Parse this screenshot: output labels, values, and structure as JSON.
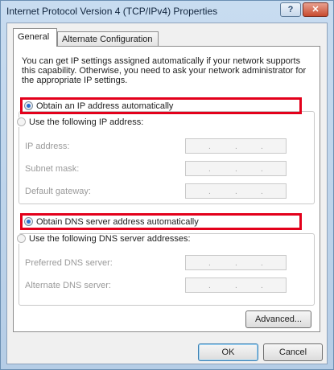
{
  "window": {
    "title": "Internet Protocol Version 4 (TCP/IPv4) Properties",
    "help_label": "?",
    "close_label": "✕"
  },
  "tabs": [
    {
      "label": "General",
      "selected": true
    },
    {
      "label": "Alternate Configuration",
      "selected": false
    }
  ],
  "description": "You can get IP settings assigned automatically if your network supports this capability. Otherwise, you need to ask your network administrator for the appropriate IP settings.",
  "ip": {
    "auto_label": "Obtain an IP address automatically",
    "auto_selected": true,
    "manual_label": "Use the following IP address:",
    "fields": [
      {
        "label": "IP address:",
        "value": ". . ."
      },
      {
        "label": "Subnet mask:",
        "value": ". . ."
      },
      {
        "label": "Default gateway:",
        "value": ". . ."
      }
    ]
  },
  "dns": {
    "auto_label": "Obtain DNS server address automatically",
    "auto_selected": true,
    "manual_label": "Use the following DNS server addresses:",
    "fields": [
      {
        "label": "Preferred DNS server:",
        "value": ". . ."
      },
      {
        "label": "Alternate DNS server:",
        "value": ". . ."
      }
    ]
  },
  "buttons": {
    "advanced": "Advanced...",
    "ok": "OK",
    "cancel": "Cancel"
  },
  "colors": {
    "highlight": "#e3001b",
    "radio_selected": "#2a6fd0"
  }
}
